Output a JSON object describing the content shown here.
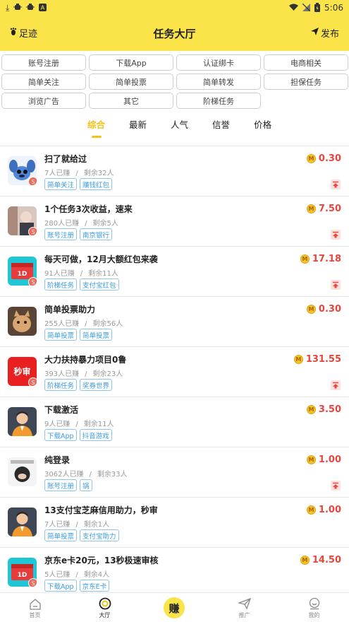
{
  "status_bar": {
    "left_icons": [
      "download-icon",
      "bug-icon",
      "bug-icon",
      "a-icon"
    ],
    "time": "5:06"
  },
  "header": {
    "left_label": "足迹",
    "title": "任务大厅",
    "right_label": "发布"
  },
  "categories": [
    "账号注册",
    "下载App",
    "认证绑卡",
    "电商相关",
    "简单关注",
    "简单投票",
    "简单转发",
    "担保任务",
    "浏览广告",
    "其它",
    "阶梯任务"
  ],
  "tabs": [
    {
      "label": "综合",
      "active": true
    },
    {
      "label": "最新",
      "active": false
    },
    {
      "label": "人气",
      "active": false
    },
    {
      "label": "信誉",
      "active": false
    },
    {
      "label": "价格",
      "active": false
    }
  ],
  "tasks": [
    {
      "title": "扫了就给过",
      "done": "7人已赚",
      "sep": "/",
      "left": "剩余32人",
      "tags": [
        "简单关注",
        "赚钱红包"
      ],
      "price": "0.30",
      "thumb": "stitch",
      "badge": "S",
      "top": true
    },
    {
      "title": "1个任务3次收益，速来",
      "done": "280人已赚",
      "sep": "/",
      "left": "剩余5人",
      "tags": [
        "账号注册",
        "南京银行"
      ],
      "price": "7.50",
      "thumb": "photo",
      "badge": "S",
      "top": true
    },
    {
      "title": "每天可做，12月大额红包来袭",
      "done": "91人已赚",
      "sep": "/",
      "left": "剩余11人",
      "tags": [
        "阶梯任务",
        "支付宝红包"
      ],
      "price": "17.18",
      "thumb": "redpacket",
      "badge": "S",
      "top": true
    },
    {
      "title": "简单投票助力",
      "done": "255人已赚",
      "sep": "/",
      "left": "剩余56人",
      "tags": [
        "简单投票",
        "简单投票"
      ],
      "price": "0.30",
      "thumb": "cat",
      "badge": "",
      "top": false
    },
    {
      "title": "大力扶持暴力项目0鲁",
      "done": "393人已赚",
      "sep": "/",
      "left": "剩余23人",
      "tags": [
        "阶梯任务",
        "奖券世界"
      ],
      "price": "131.55",
      "thumb": "miaoshen",
      "thumb_text": "秒审",
      "badge": "S",
      "top": true
    },
    {
      "title": "下载激活",
      "done": "9人已赚",
      "sep": "/",
      "left": "剩余11人",
      "tags": [
        "下载App",
        "抖音游戏"
      ],
      "price": "3.50",
      "thumb": "avatar",
      "badge": "",
      "top": false
    },
    {
      "title": "纯登录",
      "done": "3062人已赚",
      "sep": "/",
      "left": "剩余33人",
      "tags": [
        "账号注册",
        "锅"
      ],
      "price": "1.00",
      "thumb": "face",
      "badge": "",
      "top": true
    },
    {
      "title": "13支付宝芝麻信用助力，秒审",
      "done": "7人已赚",
      "sep": "/",
      "left": "剩余1人",
      "tags": [
        "简单投票",
        "支付宝助力"
      ],
      "price": "1.00",
      "thumb": "avatar",
      "badge": "",
      "top": false
    },
    {
      "title": "京东e卡20元，13秒极速审核",
      "done": "5人已赚",
      "sep": "/",
      "left": "剩余4人",
      "tags": [
        "下载App",
        "京东E卡"
      ],
      "price": "14.50",
      "thumb": "redpacket",
      "badge": "S",
      "top": false
    }
  ],
  "bottom_nav": [
    {
      "label": "首页",
      "icon": "home-icon",
      "active": false
    },
    {
      "label": "大厅",
      "icon": "hall-icon",
      "active": true
    },
    {
      "label": "",
      "icon": "earn",
      "active": false
    },
    {
      "label": "推广",
      "icon": "send-icon",
      "active": false
    },
    {
      "label": "我的",
      "icon": "user-icon",
      "active": false
    }
  ],
  "earn_label": "赚",
  "colors": {
    "brand_yellow": "#fbe34a",
    "price_red": "#e8453c",
    "tag_blue": "#3a9be0",
    "tab_active": "#f0c419"
  }
}
